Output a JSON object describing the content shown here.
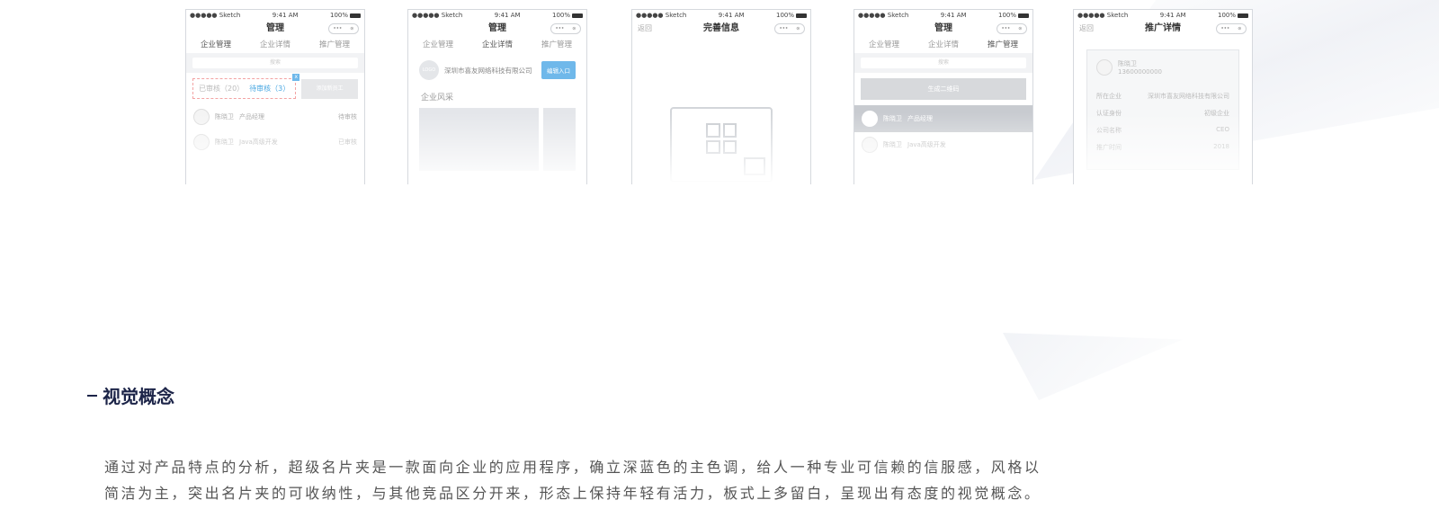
{
  "status": {
    "carrier": "●●●●● Sketch",
    "time": "9:41 AM",
    "battery": "100%"
  },
  "capsule": {
    "dots": "•••",
    "circle": "⊙"
  },
  "phones": [
    {
      "title": "管理",
      "tabs": [
        "企业管理",
        "企业详情",
        "推广管理"
      ],
      "search": "搜索",
      "reviewed": "已审核（20）",
      "pending": "待审核（3）",
      "corner": "x",
      "action": "添加新员工",
      "rows": [
        {
          "name": "陈晓卫",
          "role": "产品经理",
          "right": "待审核"
        },
        {
          "name": "陈晓卫",
          "role": "Java高级开发",
          "right": "已审核"
        }
      ]
    },
    {
      "title": "管理",
      "tabs": [
        "企业管理",
        "企业详情",
        "推广管理"
      ],
      "company": "深圳市喜友网络科技有限公司",
      "company_avatar": "LOGO",
      "edit": "编辑入口",
      "section": "企业风采"
    },
    {
      "back": "返回",
      "title": "完善信息"
    },
    {
      "title": "管理",
      "tabs": [
        "企业管理",
        "企业详情",
        "推广管理"
      ],
      "search": "搜索",
      "action": "生成二维码",
      "rows": [
        {
          "name": "陈晓卫",
          "role": "产品经理"
        },
        {
          "name": "陈晓卫",
          "role": "Java高级开发"
        }
      ]
    },
    {
      "back": "返回",
      "title": "推广详情",
      "person": "陈晓卫",
      "phone": "13600000000",
      "fields": [
        {
          "k": "所在企业",
          "v": "深圳市喜友网络科技有限公司"
        },
        {
          "k": "认证身份",
          "v": "初级企业"
        },
        {
          "k": "公司名称",
          "v": "CEO"
        },
        {
          "k": "推广时间",
          "v": "2018"
        }
      ]
    }
  ],
  "heading": "视觉概念",
  "paragraph": [
    "通过对产品特点的分析，超级名片夹是一款面向企业的应用程序，确立深蓝色的主色调，给人一种专业可信赖的信服感，风格以",
    "简洁为主，突出名片夹的可收纳性，与其他竞品区分开来，形态上保持年轻有活力，板式上多留白，呈现出有态度的视觉概念。"
  ]
}
